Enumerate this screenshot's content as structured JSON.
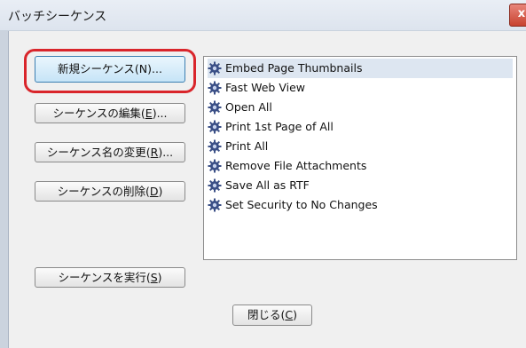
{
  "window": {
    "title": "バッチシーケンス",
    "close_label": "x"
  },
  "buttons": {
    "new": "新規シーケンス(N)...",
    "edit_prefix": "シーケンスの編集(",
    "edit_key": "E",
    "edit_suffix": ")...",
    "rename_prefix": "シーケンス名の変更(",
    "rename_key": "R",
    "rename_suffix": ")...",
    "delete_prefix": "シーケンスの削除(",
    "delete_key": "D",
    "delete_suffix": ")",
    "run_prefix": "シーケンスを実行(",
    "run_key": "S",
    "run_suffix": ")",
    "close_prefix": "閉じる(",
    "close_key": "C",
    "close_suffix": ")"
  },
  "sequences": [
    {
      "label": "Embed Page Thumbnails",
      "icon": "gear-icon",
      "selected": true
    },
    {
      "label": "Fast Web View",
      "icon": "gear-icon"
    },
    {
      "label": "Open All",
      "icon": "gear-icon"
    },
    {
      "label": "Print 1st Page of All",
      "icon": "gear-icon"
    },
    {
      "label": "Print All",
      "icon": "gear-icon"
    },
    {
      "label": "Remove File Attachments",
      "icon": "gear-icon"
    },
    {
      "label": "Save All as RTF",
      "icon": "gear-icon"
    },
    {
      "label": "Set Security to No Changes",
      "icon": "gear-icon"
    }
  ],
  "colors": {
    "highlight": "#d9252b",
    "selection": "#dde6f1",
    "default_button_border": "#3c7fb1"
  }
}
